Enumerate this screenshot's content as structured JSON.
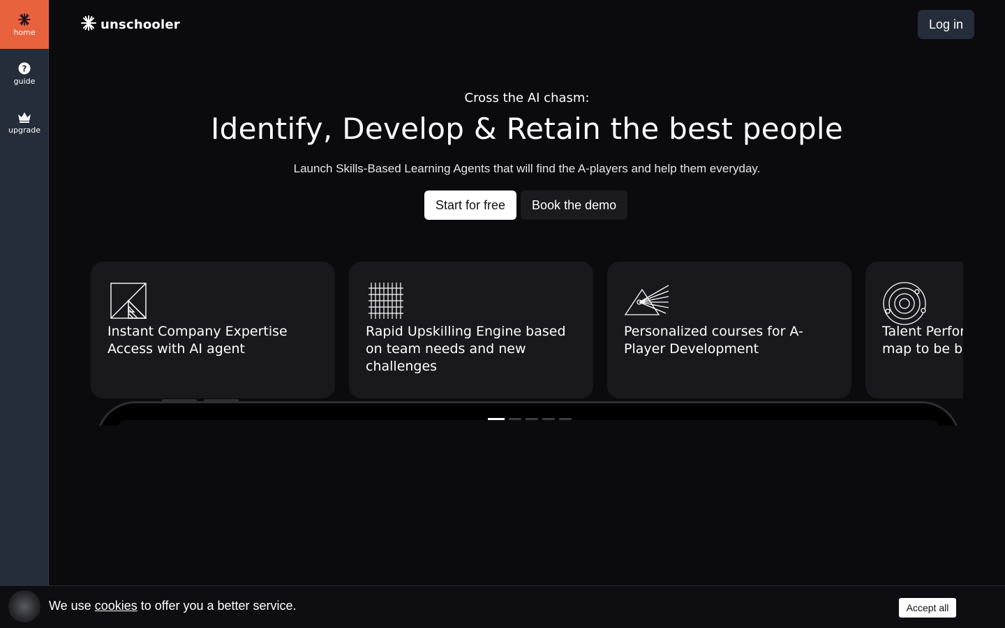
{
  "sidebar": {
    "items": [
      {
        "label": "home",
        "icon": "burst-icon",
        "active": true
      },
      {
        "label": "guide",
        "icon": "question-circle-icon"
      },
      {
        "label": "upgrade",
        "icon": "crown-icon"
      }
    ]
  },
  "header": {
    "brand": "unschooler",
    "login_label": "Log in"
  },
  "hero": {
    "kicker": "Cross the AI chasm:",
    "headline": "Identify, Develop & Retain the best people",
    "subline": "Launch Skills-Based Learning Agents that will find the A-players and help them everyday.",
    "cta_primary": "Start for free",
    "cta_secondary": "Book the demo"
  },
  "cards": [
    {
      "icon": "expertise-icon",
      "title": "Instant Company Expertise Access with AI agent"
    },
    {
      "icon": "grid-engine-icon",
      "title": "Rapid Upskilling Engine based on team needs and new challenges"
    },
    {
      "icon": "prism-icon",
      "title": "Personalized courses for A-Player Development"
    },
    {
      "icon": "orbit-icon",
      "title": "Talent Performance with skills map to be best"
    }
  ],
  "carousel": {
    "slides": 5,
    "active": 0
  },
  "cookie": {
    "prefix": "We use",
    "link": "cookies",
    "suffix": "to offer you a better service.",
    "accept_label": "Accept all"
  },
  "colors": {
    "accent": "#e8623d",
    "background": "#0b0a0d",
    "sidebar": "#262d3a",
    "card": "#19181c"
  }
}
